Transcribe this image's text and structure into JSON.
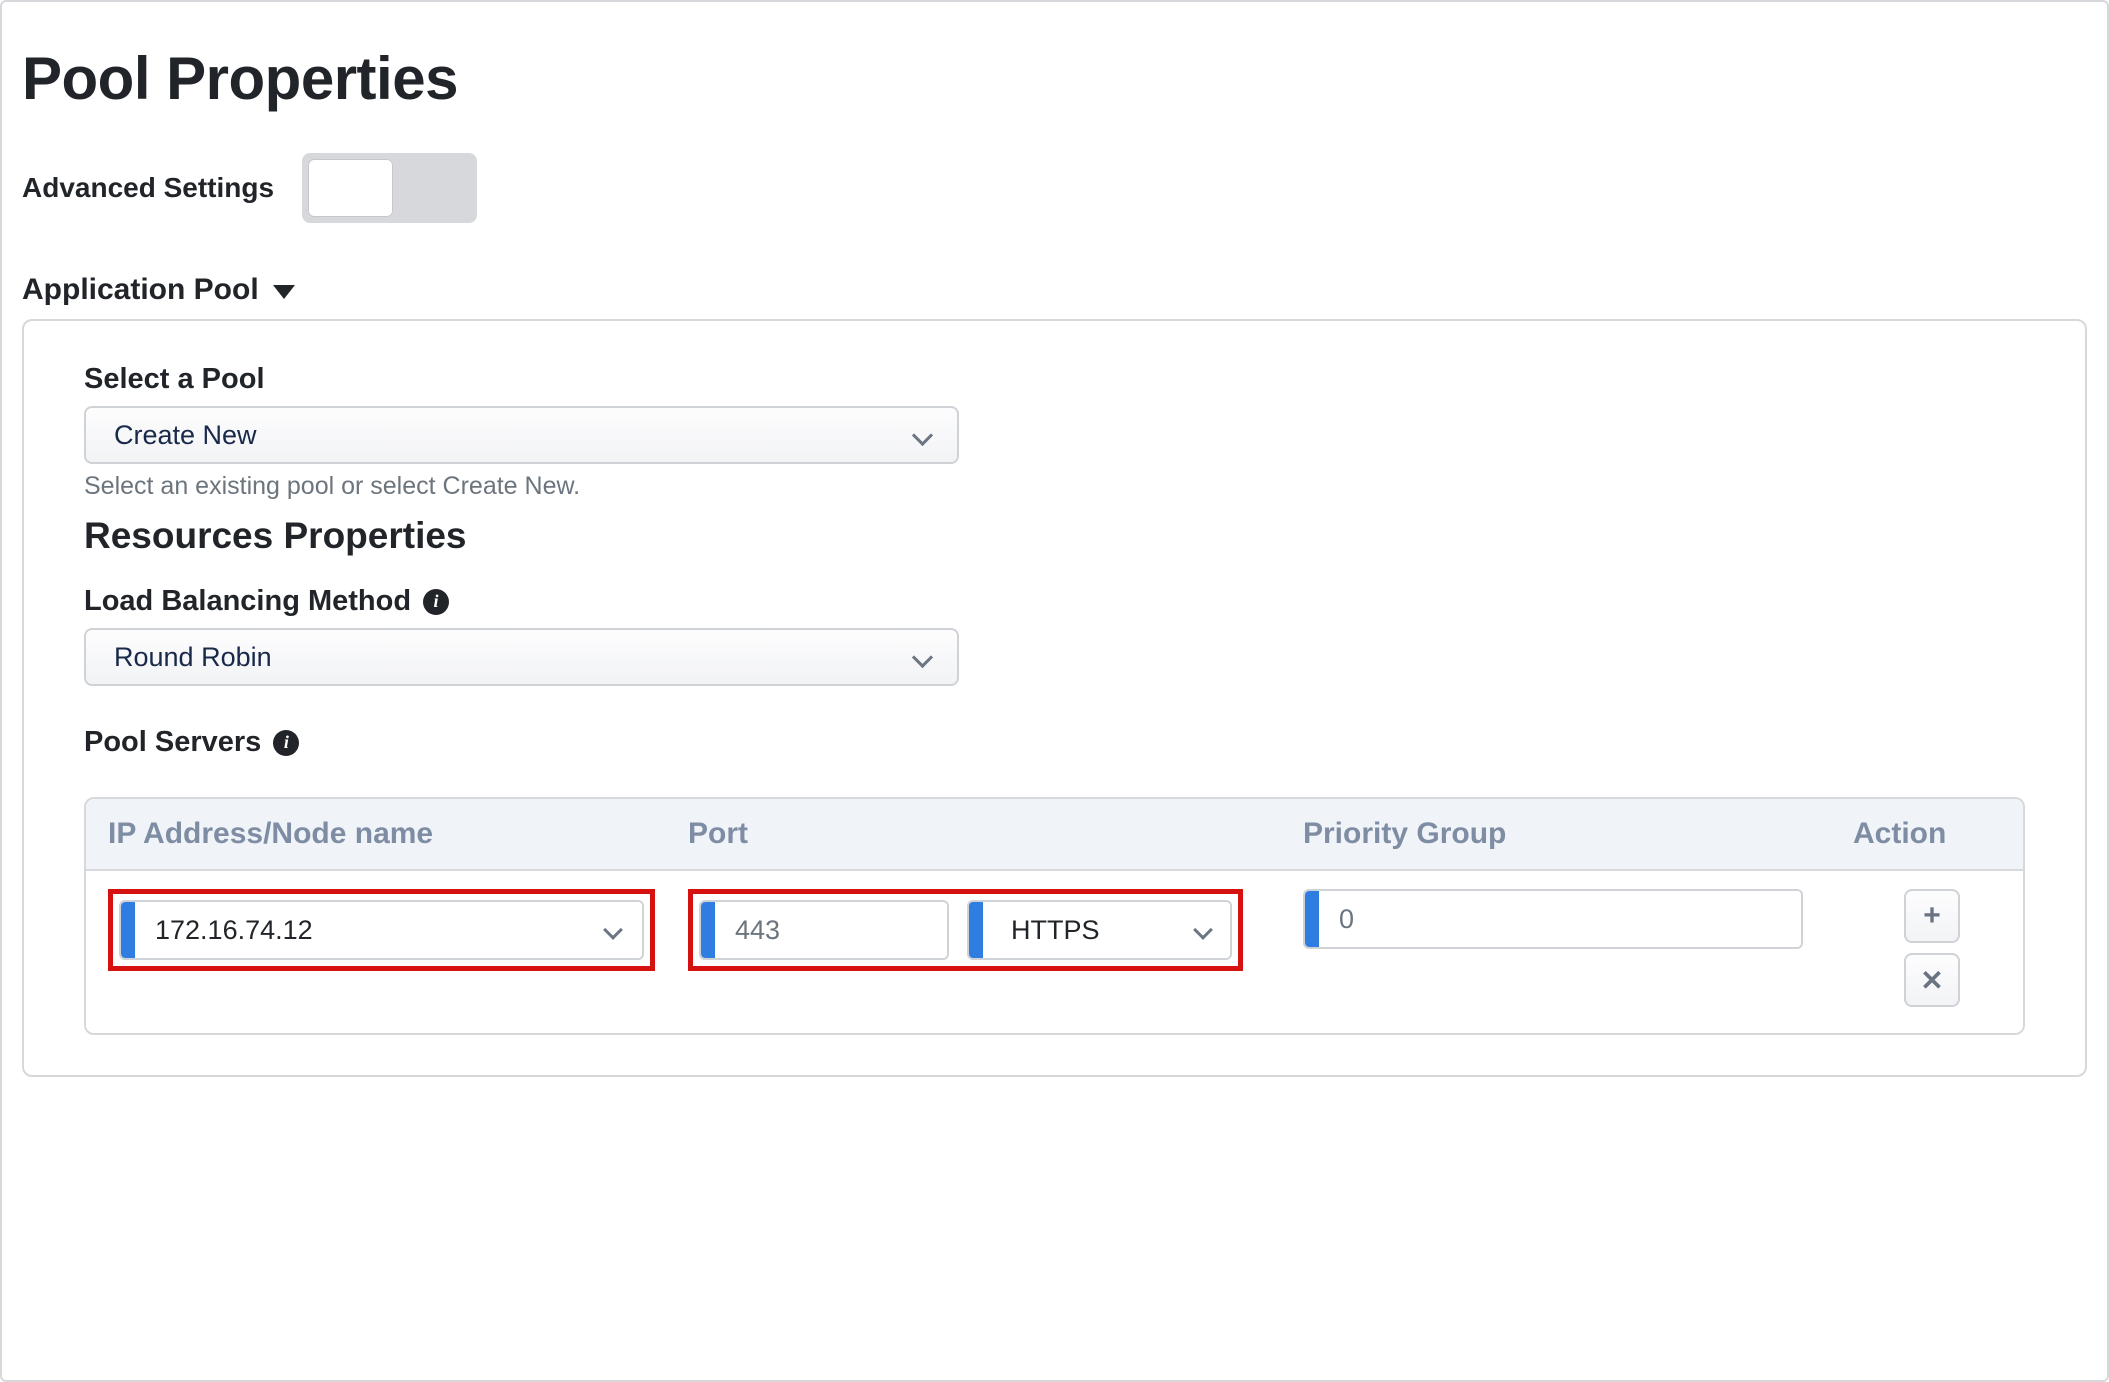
{
  "title": "Pool Properties",
  "advanced_label": "Advanced Settings",
  "advanced_on": false,
  "section_header": "Application Pool",
  "select_pool": {
    "label": "Select a Pool",
    "value": "Create New",
    "help": "Select an existing pool or select Create New."
  },
  "resources_heading": "Resources Properties",
  "lb_method": {
    "label": "Load Balancing Method",
    "value": "Round Robin"
  },
  "pool_servers_label": "Pool Servers",
  "table": {
    "headers": {
      "ip": "IP Address/Node name",
      "port": "Port",
      "priority": "Priority Group",
      "action": "Action"
    },
    "rows": [
      {
        "ip": "172.16.74.12",
        "port": "443",
        "protocol": "HTTPS",
        "priority": "0"
      }
    ]
  },
  "icons": {
    "info": "i",
    "plus": "+",
    "close": "✕"
  }
}
